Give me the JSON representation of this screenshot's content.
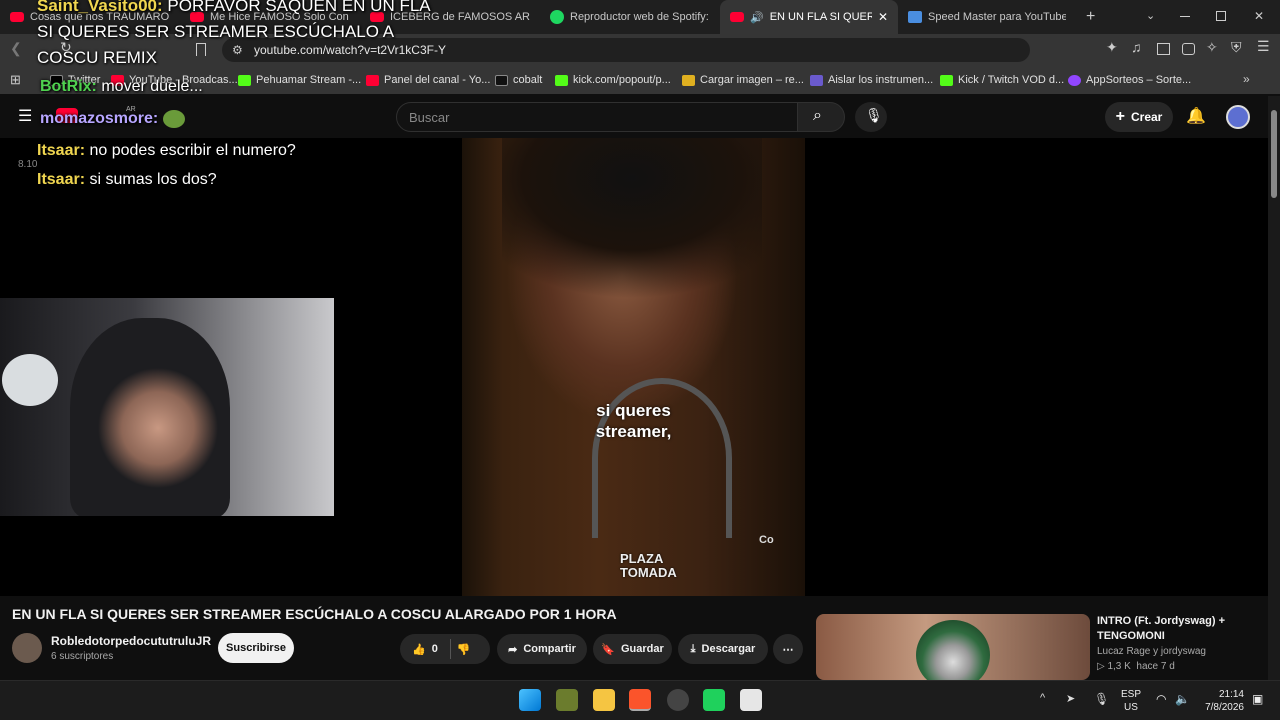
{
  "browser": {
    "tabs": [
      {
        "label": "Cosas que nos TRAUMARON d",
        "favicon": "youtube-icon"
      },
      {
        "label": "Me Hice FAMOSO Solo Con M",
        "favicon": "youtube-icon"
      },
      {
        "label": "ICEBERG de FAMOSOS ARGENT",
        "favicon": "youtube-icon"
      },
      {
        "label": "Reproductor web de Spotify: m",
        "favicon": "spotify-icon"
      },
      {
        "label": "EN UN FLA SI QUERES S",
        "favicon": "youtube-icon",
        "active": true
      },
      {
        "label": "Speed Master para YouTube, Tr",
        "favicon": "extension-icon"
      }
    ],
    "url": "youtube.com/watch?v=t2Vr1kC3F-Y",
    "bookmarks": [
      {
        "label": "Twitter"
      },
      {
        "label": "YouTube - Broadcas..."
      },
      {
        "label": "Pehuamar Stream -..."
      },
      {
        "label": "Panel del canal - Yo..."
      },
      {
        "label": "cobalt"
      },
      {
        "label": "kick.com/popout/p..."
      },
      {
        "label": "Cargar imagen – re..."
      },
      {
        "label": "Aislar los instrumen..."
      },
      {
        "label": "Kick / Twitch VOD d..."
      },
      {
        "label": "AppSorteos – Sorte..."
      }
    ]
  },
  "youtube": {
    "logo_badge": "AR",
    "search_placeholder": "Buscar",
    "create_label": "Crear"
  },
  "overlay": {
    "chat": [
      {
        "user": "Saint_Vasito00:",
        "text": "PORFAVOR SAQUEN EN UN FLA"
      },
      {
        "user": "",
        "text": "SI QUERES SER STREAMER ESCÚCHALO A"
      },
      {
        "user": "",
        "text": "COSCU REMIX"
      },
      {
        "user": "BotRix:",
        "text": "mover duele..."
      },
      {
        "user": "momazosmore:",
        "text": ""
      },
      {
        "user": "Itsaar:",
        "text": "no podes escribir el numero?"
      },
      {
        "user": "Itsaar:",
        "text": "si sumas los dos?"
      }
    ],
    "small_number": "8.10"
  },
  "video": {
    "caption_line1": "si queres",
    "caption_line2": "streamer,",
    "watermark": "PLAZA\nTOMADA",
    "corner_text": "Co"
  },
  "meta": {
    "title": "EN UN FLA SI QUERES SER STREAMER ESCÚCHALO A COSCU ALARGADO POR 1 HORA",
    "channel": "RobledotorpedocututruluJR",
    "subscribers": "6 suscriptores",
    "subscribe_label": "Suscribirse",
    "like_count": "0",
    "share_label": "Compartir",
    "save_label": "Guardar",
    "download_label": "Descargar"
  },
  "recommended": [
    {
      "title": "INTRO (Ft. Jordyswag) + TENGOMONI",
      "channel": "Lucaz Rage y jordyswag",
      "views": "1,3 K",
      "age": "hace 7 d"
    }
  ],
  "taskbar": {
    "lang_top": "ESP",
    "lang_bottom": "US",
    "time": "21:14",
    "date": "7/8/2026"
  }
}
